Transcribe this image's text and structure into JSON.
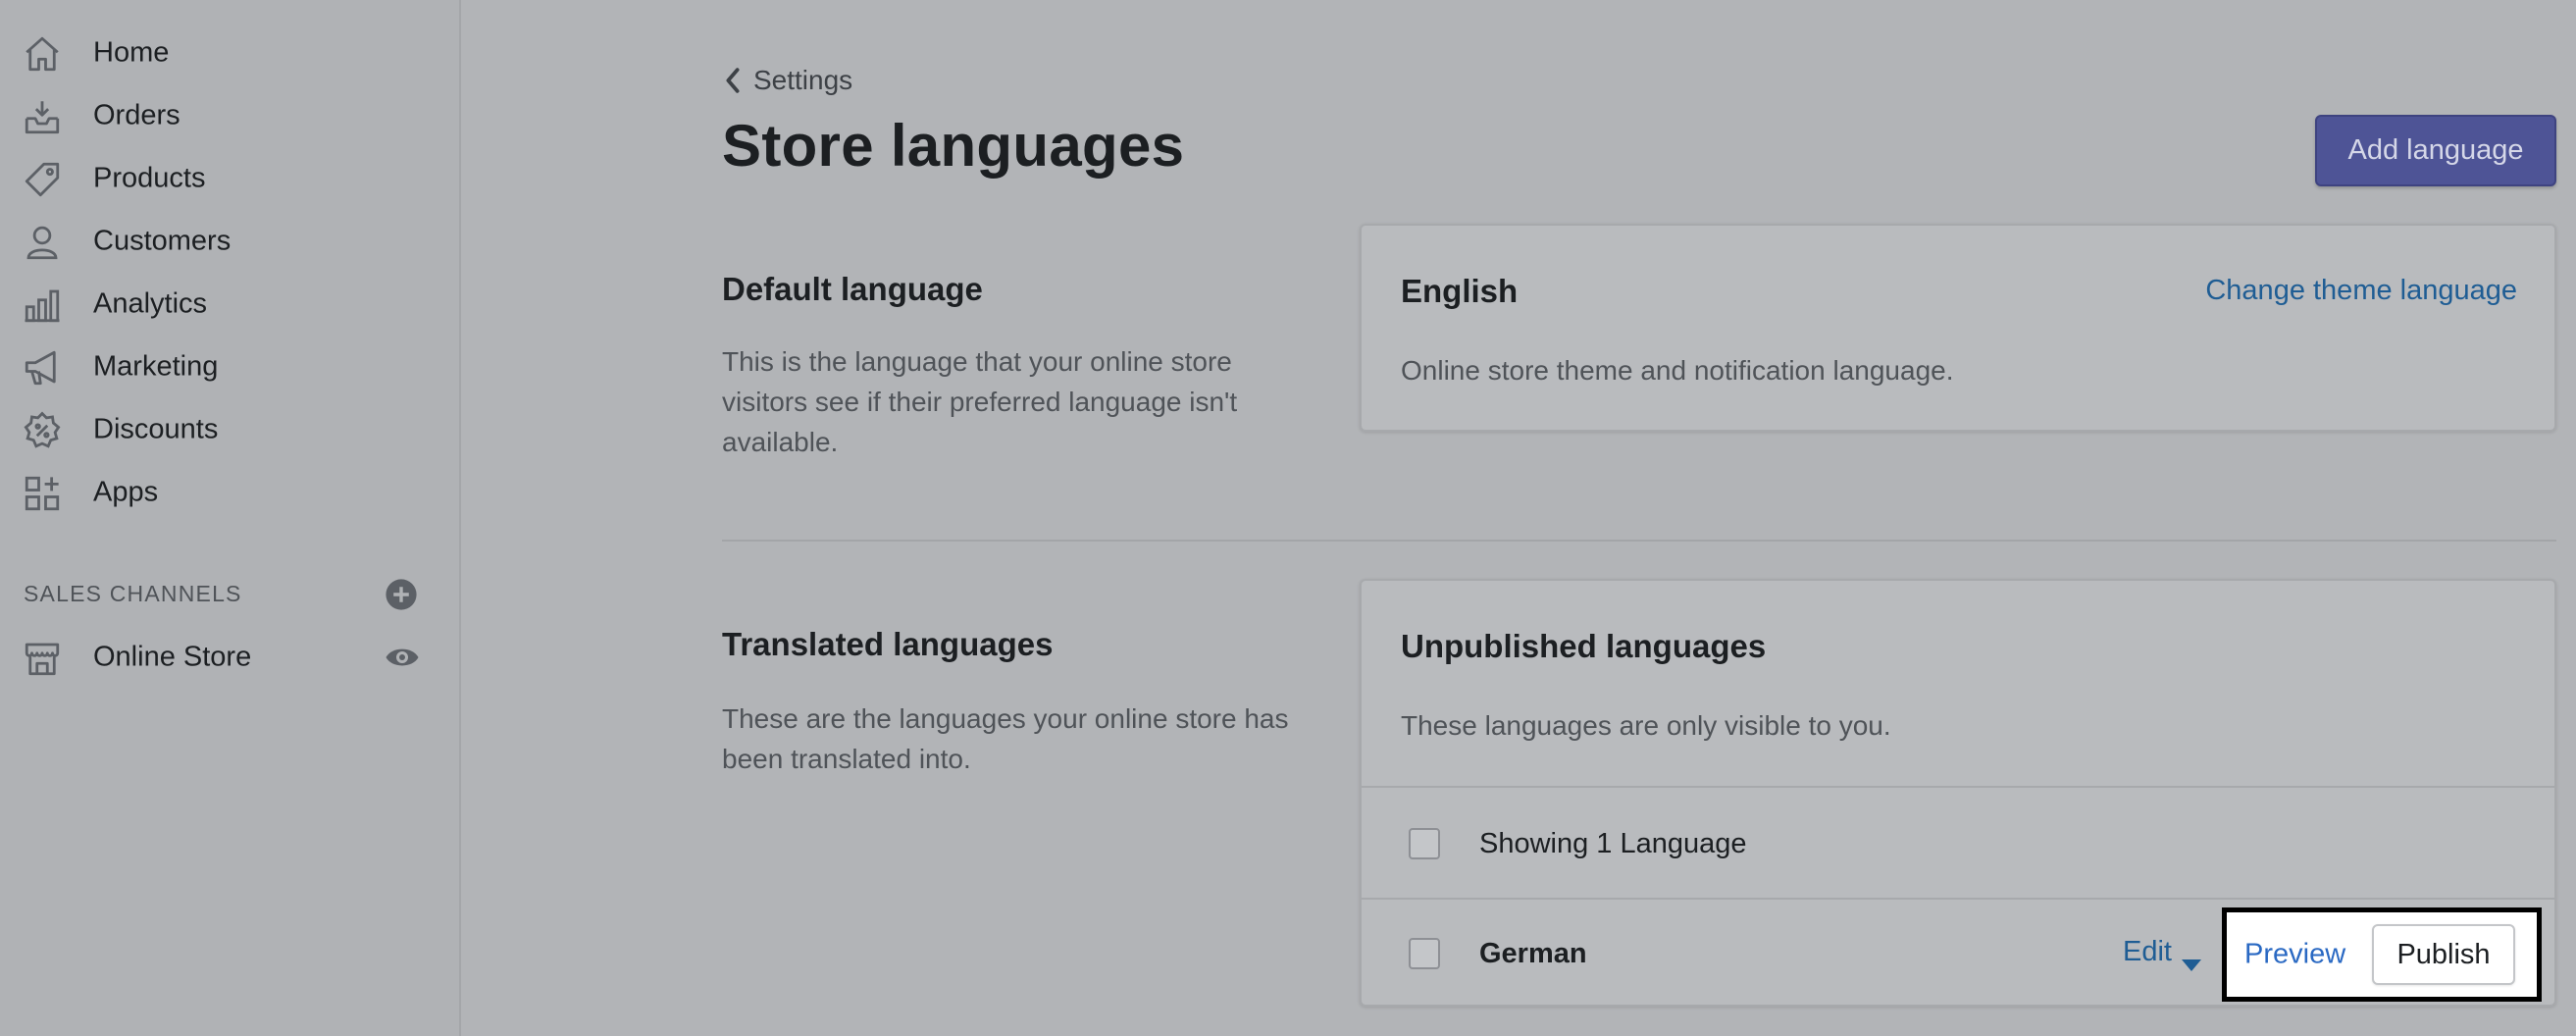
{
  "sidebar": {
    "items": [
      {
        "label": "Home",
        "icon": "home-icon"
      },
      {
        "label": "Orders",
        "icon": "orders-icon"
      },
      {
        "label": "Products",
        "icon": "tag-icon"
      },
      {
        "label": "Customers",
        "icon": "person-icon"
      },
      {
        "label": "Analytics",
        "icon": "bar-chart-icon"
      },
      {
        "label": "Marketing",
        "icon": "megaphone-icon"
      },
      {
        "label": "Discounts",
        "icon": "discount-icon"
      },
      {
        "label": "Apps",
        "icon": "apps-icon"
      }
    ],
    "sales_channels_heading": "SALES CHANNELS",
    "online_store_label": "Online Store"
  },
  "header": {
    "breadcrumb": "Settings",
    "title": "Store languages",
    "add_button": "Add language"
  },
  "default_section": {
    "title": "Default language",
    "description": "This is the language that your online store visitors see if their preferred language isn't available.",
    "card": {
      "language": "English",
      "change_link": "Change theme language",
      "note": "Online store theme and notification language."
    }
  },
  "translated_section": {
    "title": "Translated languages",
    "description": "These are the languages your online store has been translated into.",
    "card": {
      "heading": "Unpublished languages",
      "note": "These languages are only visible to you.",
      "select_all_label": "Showing 1 Language",
      "rows": [
        {
          "language": "German",
          "edit": "Edit",
          "preview": "Preview",
          "publish": "Publish"
        }
      ]
    }
  },
  "colors": {
    "primary_button": "#4e5496",
    "link": "#1f5d94",
    "highlight_border": "#000000"
  }
}
